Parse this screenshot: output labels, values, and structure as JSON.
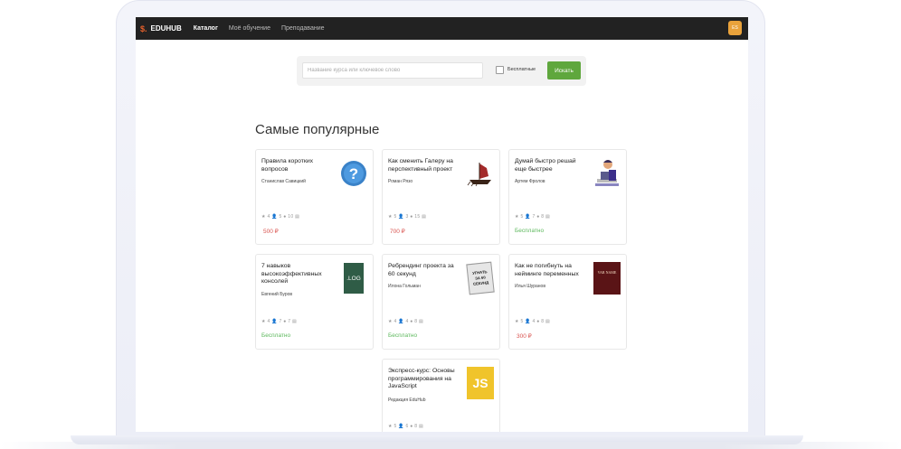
{
  "navbar": {
    "logo_mark": "$.",
    "logo_text": "EDUHUB",
    "items": [
      "Каталог",
      "Моё обучение",
      "Преподавание"
    ],
    "avatar_initials": "ES",
    "avatar_color": "#e9a23b"
  },
  "search": {
    "placeholder": "Название курса или ключевое слово",
    "free_label": "Бесплатные",
    "button_label": "Искать"
  },
  "section_title": "Самые популярные",
  "courses": [
    {
      "title": "Правила коротких вопросов",
      "author": "Станислав Савицкий",
      "stats": "★ 4 👤 5 ● 10 ▤",
      "price": "500 ₽",
      "icon": "question-icon"
    },
    {
      "title": "Как сменить Галеру на перспективный проект",
      "author": "Роман Рязо",
      "stats": "★ 5 👤 3 ● 15 ▤",
      "price": "700 ₽",
      "icon": "galley-ship-icon"
    },
    {
      "title": "Думай быстро решай еще быстрее",
      "author": "Артем Фролов",
      "stats": "★ 5 👤 7 ● 8 ▤",
      "price": "Бесплатно",
      "icon": "thinking-person-icon"
    },
    {
      "title": "7 навыков высокоэффективных консолей",
      "author": "Евгений Буров",
      "stats": "★ 4 👤 7 ● 7 ▤",
      "price": "Бесплатно",
      "icon": "log-file-icon",
      "thumb_text": ".LOG"
    },
    {
      "title": "Ребрендинг проекта за 60 секунд",
      "author": "Илона Гольман",
      "stats": "★ 4 👤 4 ● 8 ▤",
      "price": "Бесплатно",
      "icon": "gone-in-60-icon",
      "thumb_text": "УГНАТЬ ЗА 60 СЕКУНД"
    },
    {
      "title": "Как не погибнуть на нейминге переменных",
      "author": "Илья Шуранов",
      "stats": "★ 5 👤 4 ● 8 ▤",
      "price": "300 ₽",
      "icon": "var-name-icon",
      "thumb_text": "VAR NAME"
    },
    {
      "title": "Экспресс-курс: Основы программирования на JavaScript",
      "author": "Редакция EduHub",
      "stats": "★ 5 👤 6 ● 8 ▤",
      "price": "",
      "icon": "javascript-icon",
      "thumb_text": "JS"
    }
  ],
  "colors": {
    "accent_green": "#5fa73d",
    "price_paid": "#d9534f",
    "price_free": "#5cb85c",
    "nav_bg": "#222222"
  }
}
